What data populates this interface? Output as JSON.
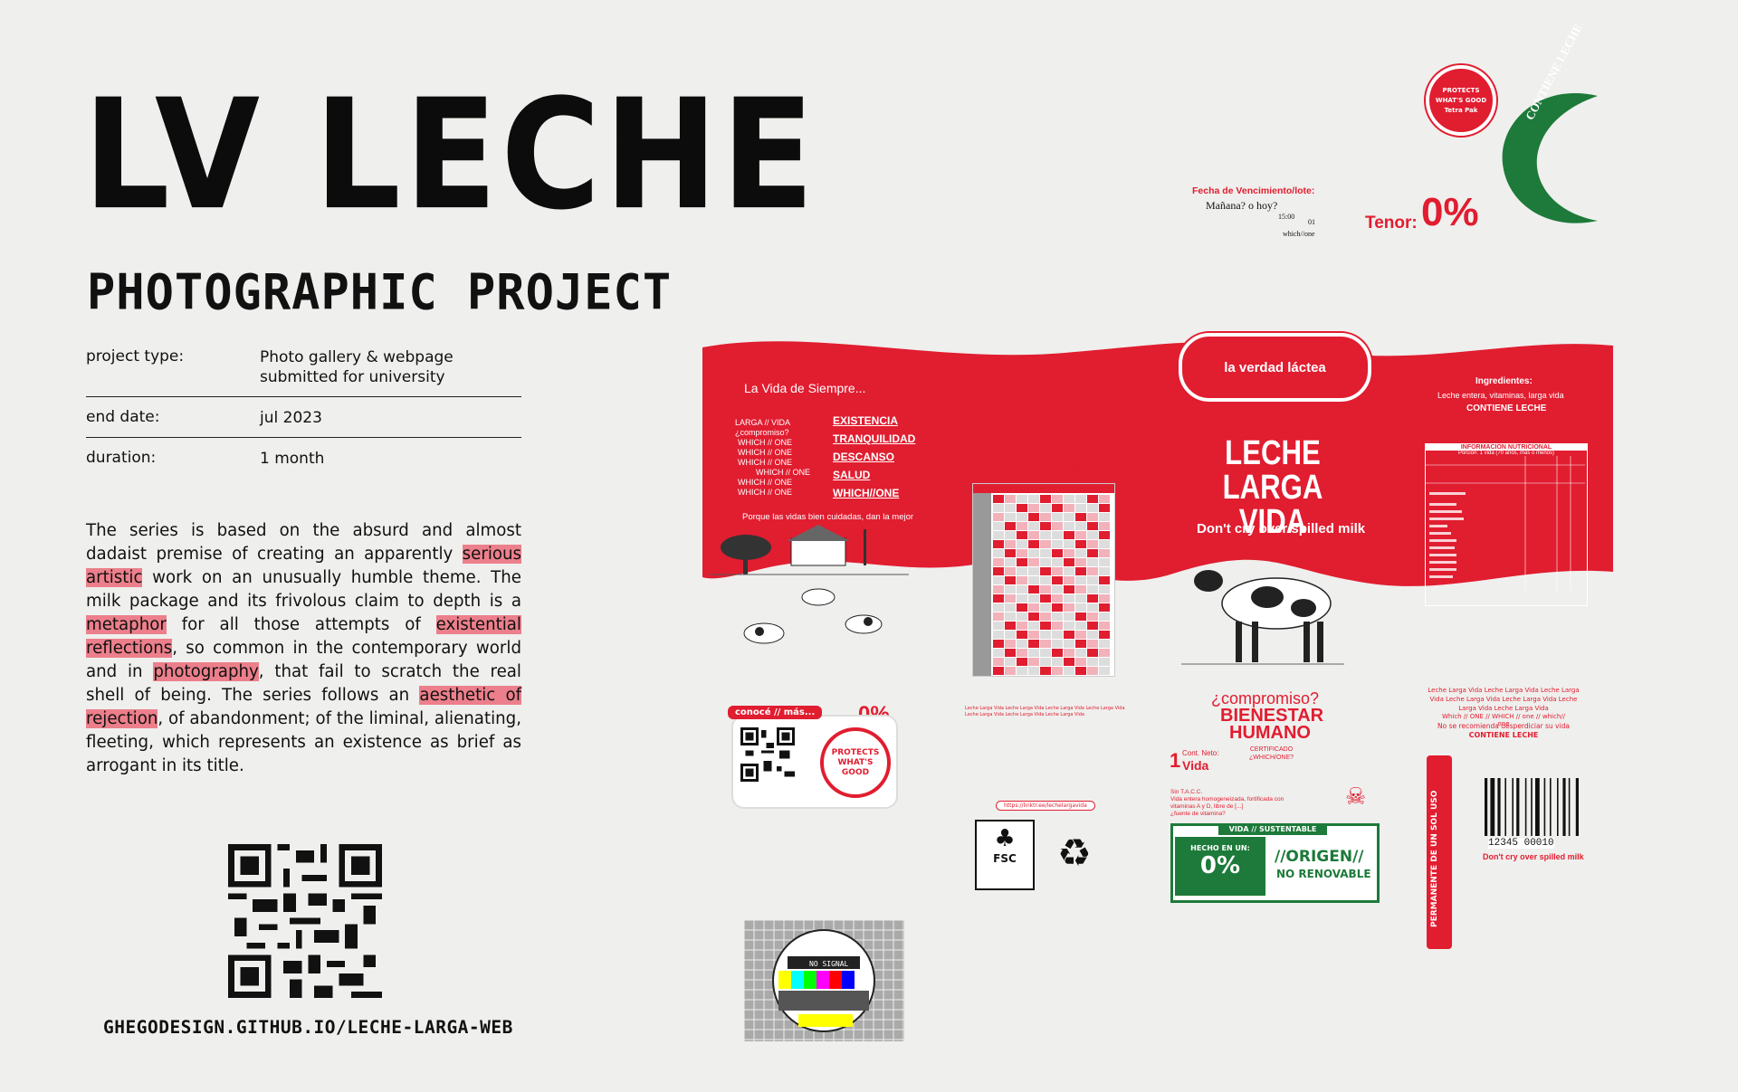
{
  "title": "LV LECHE",
  "subtitle": "PHOTOGRAPHIC PROJECT",
  "info": [
    {
      "key": "project type:",
      "value": "Photo gallery & webpage submitted for university"
    },
    {
      "key": "end date:",
      "value": "jul 2023"
    },
    {
      "key": "duration:",
      "value": "1 month"
    }
  ],
  "description": {
    "p1": "The series is based on the absurd and almost dadaist premise of creating an apparently ",
    "h1": "serious artistic",
    "p2": " work on an unusually humble theme. The milk package and its frivolous claim to depth is a ",
    "h2": "metaphor",
    "p3": " for all those attempts of ",
    "h3": "existential reflections",
    "p4": ", so common in the contemporary world and in ",
    "h4": "photography",
    "p5": ", that fail to scratch the real shell of being. The series follows an ",
    "h5": "aesthetic of rejection",
    "p6": ", of abandonment; of the liminal, alienating, fleeting, which represents an existence as brief as arrogant in its title."
  },
  "url": "GHEGODESIGN.GITHUB.IO/LECHE-LARGA-WEB",
  "package": {
    "pill": "la verdad láctea",
    "vida_siempre": "La Vida de Siempre...",
    "larga_vida_list": "LARGA // VIDA",
    "compromiso_small": "¿compromiso?",
    "which_one": "WHICH // ONE",
    "words": [
      "EXISTENCIA",
      "TRANQUILIDAD",
      "DESCANSO",
      "SALUD",
      "WHICH//ONE"
    ],
    "porque": "Porque las vidas bien cuidadas, dan la mejor",
    "dont_cry": "Don't cry over spilled milk",
    "main_title_1": "LECHE",
    "main_title_2": "LARGA VIDA",
    "ingredientes_h": "Ingredientes:",
    "ingredientes": "Leche entera, vitaminas, larga vida",
    "contiene": "CONTIENE LECHE",
    "nutri_h": "INFORMACIÓN NUTRICIONAL",
    "nutri_sub": "Porción: 1 vida (70 años, más o menos)",
    "fecha": "Fecha de Vencimiento/lote:",
    "manana": "Mañana? o hoy?",
    "hora": "15:00",
    "lote": "01",
    "which_one2": "which//one",
    "tenor_label": "Tenor:",
    "tenor_value": "0%",
    "crescent_text": "CONTIENE LECHE",
    "protects": "PROTECTS WHAT'S GOOD",
    "tetra": "Tetra Pak",
    "conoce": "conocé // más...",
    "compromiso": "¿compromiso?",
    "bienestar": "BIENESTAR",
    "humano": "HUMANO",
    "certificado": "CERTIFICADO",
    "whichone_q": "¿WHICH/ONE?",
    "cont_neto": "Cont. Neto:",
    "uno": "1",
    "vida": "Vida",
    "sust_h": "VIDA // SUSTENTABLE",
    "hecho": "HECHO EN UN:",
    "origen": "//ORIGEN//",
    "no_renovable": "NO RENOVABLE",
    "fsc": "FSC",
    "permanente": "PERMANENTE DE UN SOL USO",
    "barcode_num": "12345 00010",
    "leche_larga_repeat": "Leche Larga Vida Leche Larga Vida Leche Larga Vida Leche Larga Vida Leche Larga Vida Leche Larga Vida Leche Larga Vida",
    "which_repeat": "Which // ONE // WHICH // one // which// one",
    "no_se": "No se recomienda desperdiciar su vida",
    "link_small": "https://linktr.ee/lechelargavida",
    "sin_tacc": "Sin T.A.C.C.",
    "vida_entera": "Vida entera homogeneizada, fortificada con vitaminas A y D, libre de [...]",
    "fuente": "¿fuente de vitamina?",
    "no_signal": "NO SIGNAL"
  },
  "colors": {
    "accent": "#e11d30",
    "highlight": "#ec7f8b",
    "green": "#1d7a3a",
    "background": "#efefed"
  }
}
